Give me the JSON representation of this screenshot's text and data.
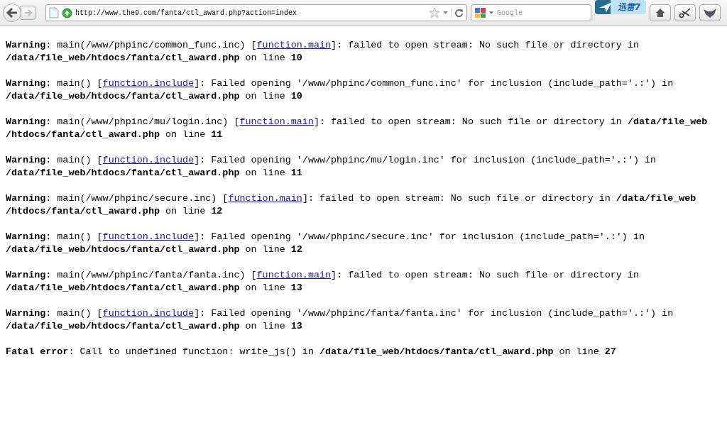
{
  "toolbar": {
    "url": "http://www.the9.com/fanta/ctl_award.php?action=index",
    "search": {
      "placeholder": "Google"
    },
    "badge": "迅雷7"
  },
  "messages": [
    {
      "before": "**Warning**: main(/www/phpinc/common_func.inc) [",
      "link": "function.main",
      "after": "]: failed to open stream: No such file or directory in\n**/data/file_web/htdocs/fanta/ctl_award.php** on line **10**"
    },
    {
      "before": "**Warning**: main() [",
      "link": "function.include",
      "after": "]: Failed opening '/www/phpinc/common_func.inc' for inclusion (include_path='.:') in\n**/data/file_web/htdocs/fanta/ctl_award.php** on line **10**"
    },
    {
      "before": "**Warning**: main(/www/phpinc/mu/login.inc) [",
      "link": "function.main",
      "after": "]: failed to open stream: No such file or directory in **/data/file_web**\n**/htdocs/fanta/ctl_award.php** on line **11**"
    },
    {
      "before": "**Warning**: main() [",
      "link": "function.include",
      "after": "]: Failed opening '/www/phpinc/mu/login.inc' for inclusion (include_path='.:') in\n**/data/file_web/htdocs/fanta/ctl_award.php** on line **11**"
    },
    {
      "before": "**Warning**: main(/www/phpinc/secure.inc) [",
      "link": "function.main",
      "after": "]: failed to open stream: No such file or directory in **/data/file_web**\n**/htdocs/fanta/ctl_award.php** on line **12**"
    },
    {
      "before": "**Warning**: main() [",
      "link": "function.include",
      "after": "]: Failed opening '/www/phpinc/secure.inc' for inclusion (include_path='.:') in\n**/data/file_web/htdocs/fanta/ctl_award.php** on line **12**"
    },
    {
      "before": "**Warning**: main(/www/phpinc/fanta/fanta.inc) [",
      "link": "function.main",
      "after": "]: failed to open stream: No such file or directory in\n**/data/file_web/htdocs/fanta/ctl_award.php** on line **13**"
    },
    {
      "before": "**Warning**: main() [",
      "link": "function.include",
      "after": "]: Failed opening '/www/phpinc/fanta/fanta.inc' for inclusion (include_path='.:') in\n**/data/file_web/htdocs/fanta/ctl_award.php** on line **13**"
    },
    {
      "before": "**Fatal error**: Call to undefined function: write_js() in **/data/file_web/htdocs/fanta/ctl_award.php** on line **27**"
    }
  ]
}
